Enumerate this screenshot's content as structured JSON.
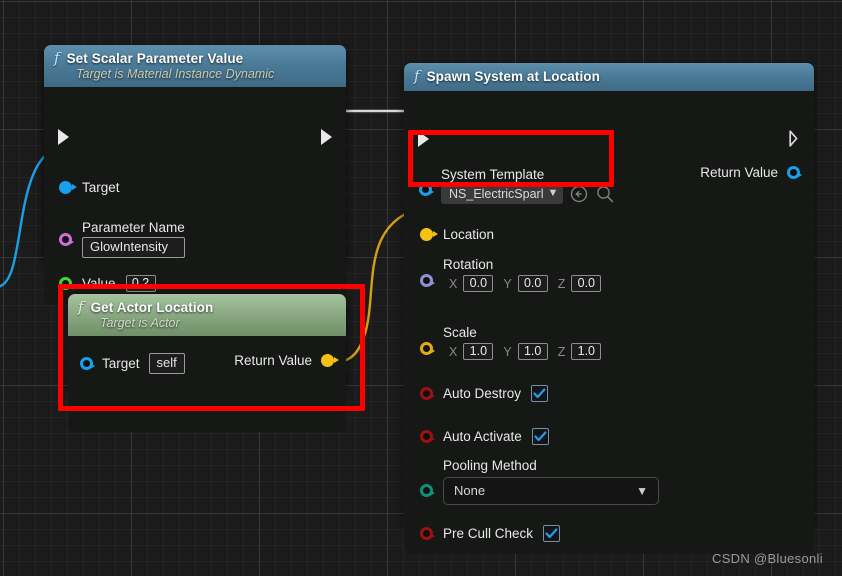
{
  "canvas": {
    "background_color": "#1b1b1b",
    "grid_color": "#2a2a2a",
    "watermark": "CSDN @Bluesonli"
  },
  "colors": {
    "exec_white": "#e8e8e8",
    "object_blue": "#18a0e8",
    "name_magenta": "#cc6ed6",
    "float_green": "#41d82b",
    "vector_yellow": "#f3c214",
    "rotator_purple": "#8f8fd6",
    "bool_red": "#9c1111",
    "enum_teal": "#0f8f7a",
    "annotation_red": "#ff0000",
    "header_blue": "#4b7b98",
    "header_green": "#8fae88",
    "check_blue": "#2b9ae8"
  },
  "nodes": {
    "set_scalar": {
      "title": "Set Scalar Parameter Value",
      "subtitle": "Target is Material Instance Dynamic",
      "fn_glyph": "f",
      "exec_in": "exec-input-pin",
      "exec_out": "exec-output-pin",
      "pins": [
        {
          "label": "Target",
          "type": "object",
          "connected": true
        },
        {
          "label": "Parameter Name",
          "type": "name",
          "value": "GlowIntensity"
        },
        {
          "label": "Value",
          "type": "float",
          "value": "0.2"
        }
      ]
    },
    "get_actor_location": {
      "title": "Get Actor Location",
      "subtitle": "Target is Actor",
      "fn_glyph": "f",
      "pins": [
        {
          "label": "Target",
          "type": "object",
          "value": "self"
        },
        {
          "label": "Return Value",
          "type": "vector",
          "connected": true
        }
      ]
    },
    "spawn_system": {
      "title": "Spawn System at Location",
      "fn_glyph": "f",
      "exec_in": "exec-input-pin",
      "exec_out": "exec-output-pin",
      "return_value_label": "Return Value",
      "system_template": {
        "label": "System Template",
        "value": "NS_ElectricSparl",
        "browse_icon": "browse-back-icon",
        "search_icon": "search-icon"
      },
      "location": {
        "label": "Location",
        "connected": true
      },
      "rotation": {
        "label": "Rotation",
        "axes": [
          "X",
          "Y",
          "Z"
        ],
        "values": [
          "0.0",
          "0.0",
          "0.0"
        ]
      },
      "scale": {
        "label": "Scale",
        "axes": [
          "X",
          "Y",
          "Z"
        ],
        "values": [
          "1.0",
          "1.0",
          "1.0"
        ]
      },
      "auto_destroy": {
        "label": "Auto Destroy",
        "checked": true
      },
      "auto_activate": {
        "label": "Auto Activate",
        "checked": true
      },
      "pooling_method": {
        "label": "Pooling Method",
        "value": "None"
      },
      "pre_cull_check": {
        "label": "Pre Cull Check",
        "checked": true
      }
    }
  },
  "annotations": [
    {
      "name": "system-template-highlight"
    },
    {
      "name": "get-actor-location-highlight"
    }
  ]
}
